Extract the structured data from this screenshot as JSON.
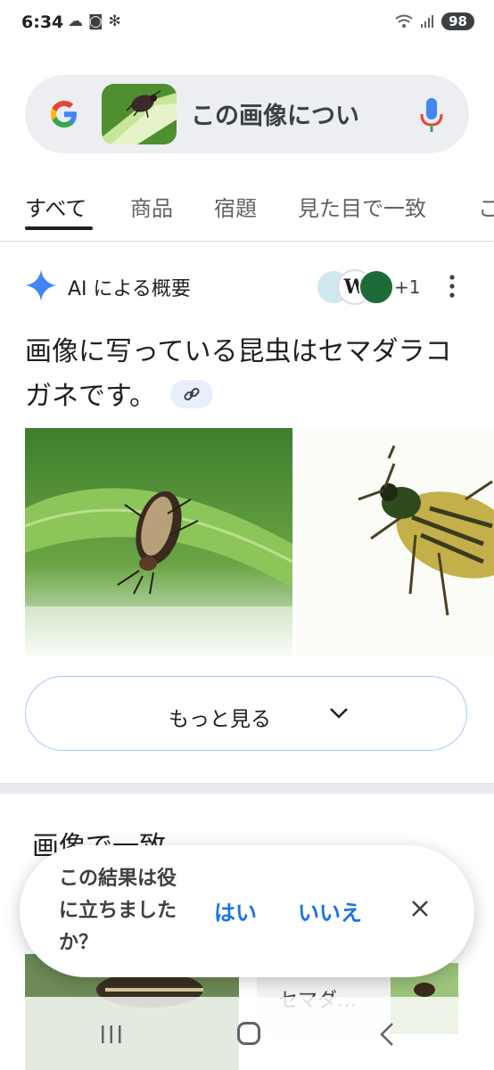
{
  "status_bar": {
    "time": "6:34",
    "battery": "98",
    "signal": "5"
  },
  "search": {
    "query": "この画像につい"
  },
  "tabs": [
    {
      "label": "すべて",
      "active": true
    },
    {
      "label": "商品"
    },
    {
      "label": "宿題"
    },
    {
      "label": "見た目で一致"
    },
    {
      "label": "こ"
    }
  ],
  "ai_overview": {
    "title": "AI による概要",
    "sources_more": "+1",
    "answer": "画像に写っている昆虫はセマダラコガネです。",
    "more_button": "もっと見る"
  },
  "visual_matches": {
    "title": "画像で一致",
    "card_text": "セマダ…"
  },
  "feedback": {
    "question": "この結果は役に立ちましたか？",
    "yes": "はい",
    "no": "いいえ"
  },
  "colors": {
    "accent": "#1a73e8",
    "chip": "#e8eefc",
    "searchbar": "#eceef1"
  }
}
